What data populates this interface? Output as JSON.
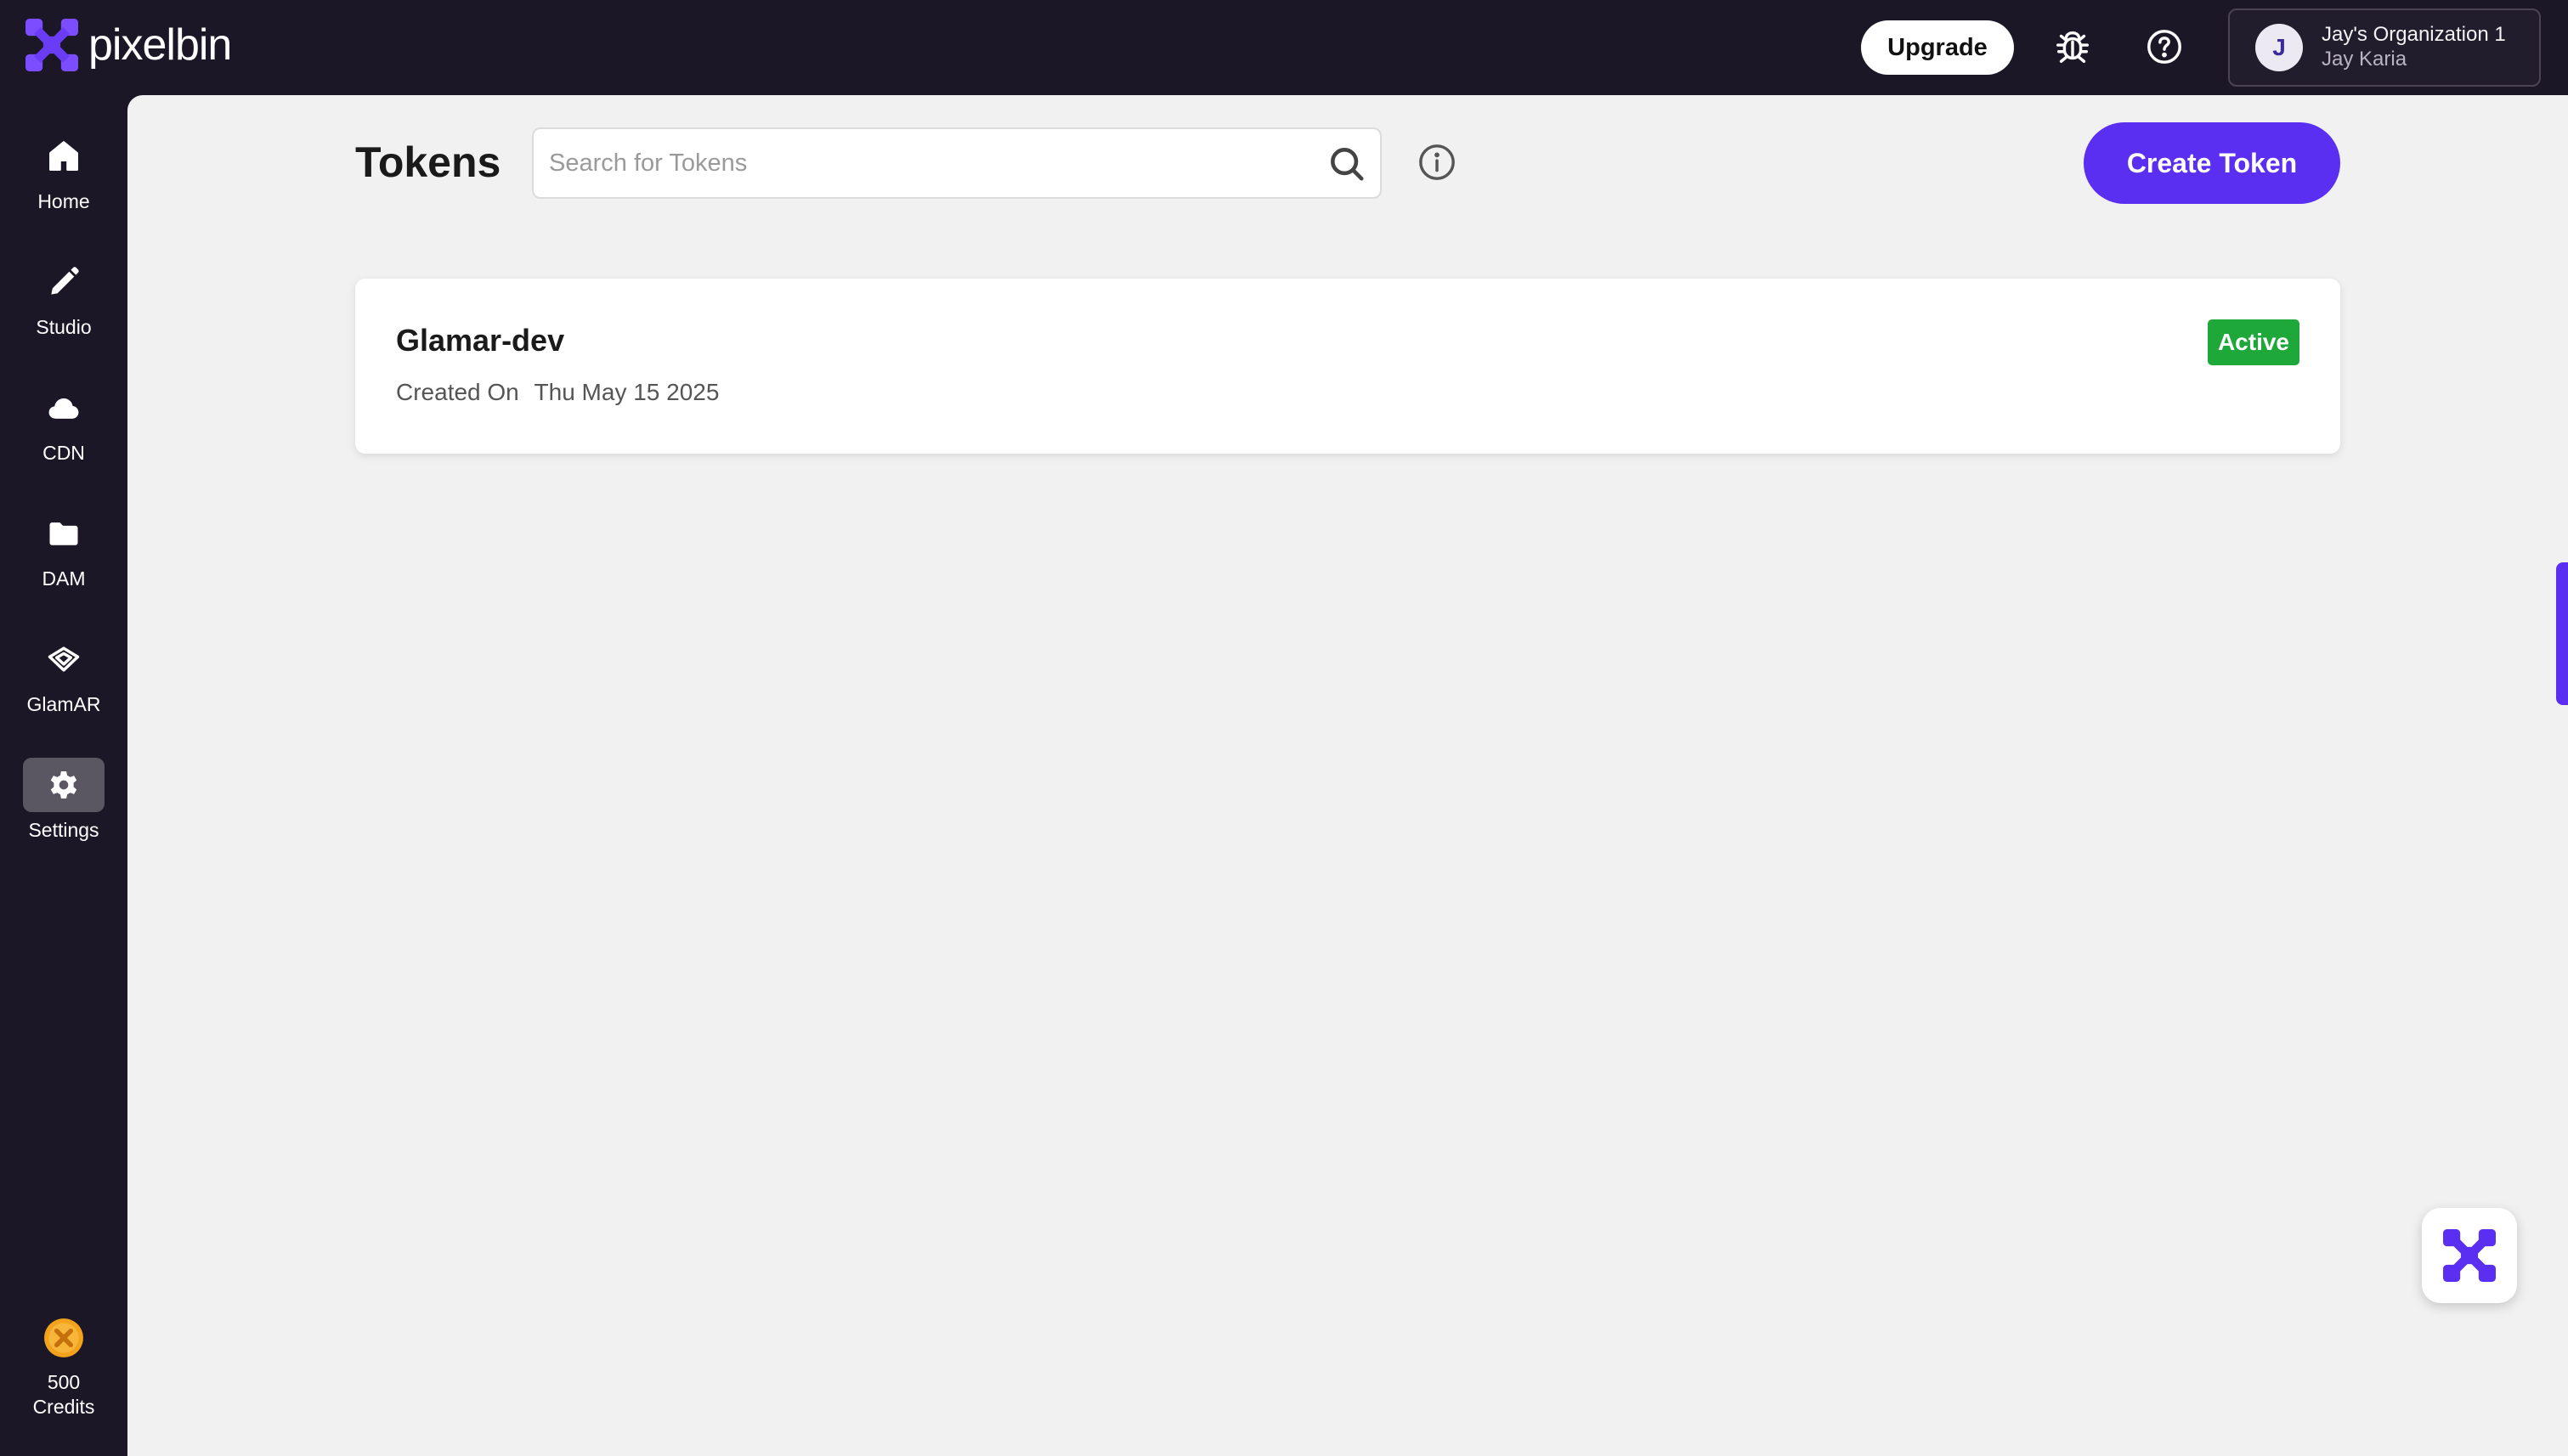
{
  "brand": {
    "name": "pixelbin",
    "accent_color": "#5b2ff2",
    "logo_icon": "pixelbin-logo-icon"
  },
  "header": {
    "upgrade_label": "Upgrade",
    "bug_report_icon": "bug-icon",
    "help_icon": "help-icon",
    "org": {
      "avatar_initial": "J",
      "name": "Jay's Organization 1",
      "user": "Jay Karia"
    }
  },
  "sidebar": {
    "items": [
      {
        "label": "Home",
        "icon": "home-icon",
        "active": false
      },
      {
        "label": "Studio",
        "icon": "pencil-icon",
        "active": false
      },
      {
        "label": "CDN",
        "icon": "cloud-icon",
        "active": false
      },
      {
        "label": "DAM",
        "icon": "folder-icon",
        "active": false
      },
      {
        "label": "GlamAR",
        "icon": "glamar-icon",
        "active": false
      },
      {
        "label": "Settings",
        "icon": "gear-icon",
        "active": true
      }
    ],
    "credits": {
      "amount": "500",
      "label": "Credits",
      "icon": "coin-icon"
    }
  },
  "main": {
    "title": "Tokens",
    "search": {
      "placeholder": "Search for Tokens",
      "value": ""
    },
    "create_label": "Create Token",
    "tokens": [
      {
        "name": "Glamar-dev",
        "created_label": "Created On",
        "created_date": "Thu May 15 2025",
        "status": "Active",
        "status_color": "#1fa83a"
      }
    ]
  }
}
